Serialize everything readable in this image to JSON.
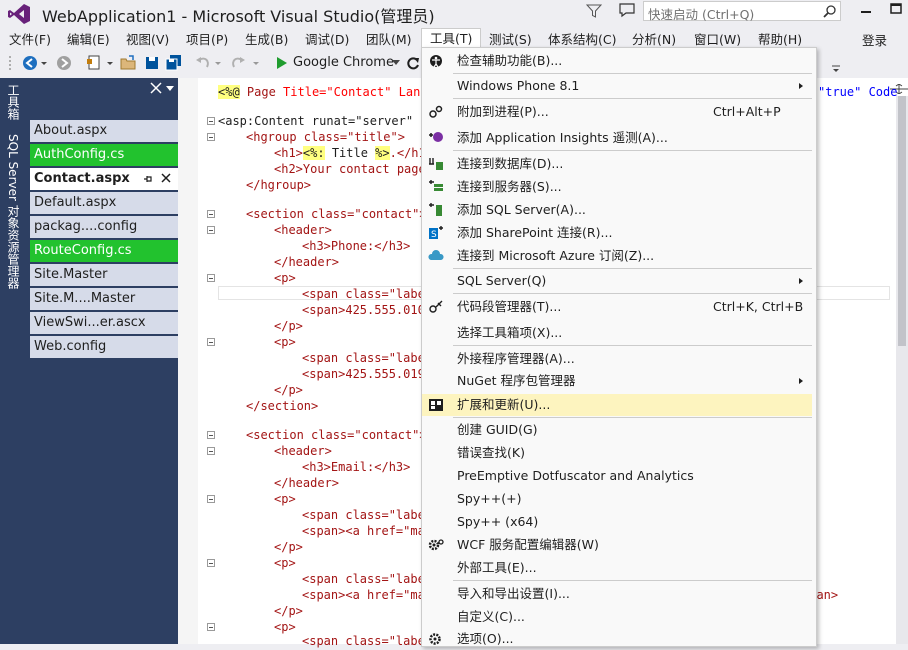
{
  "window": {
    "title": "WebApplication1 - Microsoft Visual Studio(管理员)",
    "quick_launch_placeholder": "快速启动 (Ctrl+Q)"
  },
  "menubar": {
    "items": [
      "文件(F)",
      "编辑(E)",
      "视图(V)",
      "项目(P)",
      "生成(B)",
      "调试(D)",
      "团队(M)",
      "工具(T)",
      "测试(S)",
      "体系结构(C)",
      "分析(N)",
      "窗口(W)",
      "帮助(H)"
    ],
    "login": "登录"
  },
  "toolbar": {
    "browser": "Google Chrome"
  },
  "side_tabs": [
    "工具箱",
    "SQL Server 对象资源管理器"
  ],
  "files": [
    "About.aspx",
    "AuthConfig.cs",
    "Contact.aspx",
    "Default.aspx",
    "packag....config",
    "RouteConfig.cs",
    "Site.Master",
    "Site.M....Master",
    "ViewSwi...er.ascx",
    "Web.config"
  ],
  "code": {
    "l0a": "<%@",
    "l0b": " Page ",
    "l0c": "Title=\"Contact\"",
    "l0d": " Lang",
    "l0e": "\"true\" Code",
    "l1": "<asp:Content runat=\"server\" I",
    "l2": "<hgroup class=\"title\">",
    "l3a": "<h1>",
    "l3b": "<%:",
    "l3c": " Title ",
    "l3d": "%>",
    "l3e": ".</h1",
    "l4": "<h2>Your contact page",
    "l5": "</hgroup>",
    "l6": "<section class=\"contact\">",
    "l7": "<header>",
    "l8": "<h3>Phone:</h3>",
    "l9": "</header>",
    "l10": "<p>",
    "l11": "<span class=\"labe",
    "l12": "<span>425.555.010",
    "l13": "</p>",
    "l14": "<p>",
    "l15": "<span class=\"labe",
    "l16": "<span>425.555.019",
    "l17": "</p>",
    "l18": "</section>",
    "l19": "<section class=\"contact\">",
    "l20": "<header>",
    "l21": "<h3>Email:</h3>",
    "l22": "</header>",
    "l23": "<p>",
    "l24": "<span class=\"labe",
    "l25": "<span><a href=\"ma",
    "l26": "</p>",
    "l27": "<p>",
    "l28": "<span class=\"labe",
    "l29": "<span><a href=\"ma",
    "l29b": "span>",
    "l30": "</p>",
    "l31": "<p>",
    "l32": "<span class=\"labe"
  },
  "tools_menu": {
    "items": [
      {
        "label": "检查辅助功能(B)..."
      },
      {
        "label": "Windows Phone 8.1"
      },
      {
        "label": "附加到进程(P)...",
        "shortcut": "Ctrl+Alt+P"
      },
      {
        "label": "添加 Application Insights 遥测(A)..."
      },
      {
        "label": "连接到数据库(D)..."
      },
      {
        "label": "连接到服务器(S)..."
      },
      {
        "label": "添加 SQL Server(A)..."
      },
      {
        "label": "添加 SharePoint 连接(R)..."
      },
      {
        "label": "连接到 Microsoft Azure 订阅(Z)..."
      },
      {
        "label": "SQL Server(Q)"
      },
      {
        "label": "代码段管理器(T)...",
        "shortcut": "Ctrl+K, Ctrl+B"
      },
      {
        "label": "选择工具箱项(X)..."
      },
      {
        "label": "外接程序管理器(A)..."
      },
      {
        "label": "NuGet 程序包管理器"
      },
      {
        "label": "扩展和更新(U)..."
      },
      {
        "label": "创建 GUID(G)"
      },
      {
        "label": "错误查找(K)"
      },
      {
        "label": "PreEmptive Dotfuscator and Analytics"
      },
      {
        "label": "Spy++(+)"
      },
      {
        "label": "Spy++ (x64)"
      },
      {
        "label": "WCF 服务配置编辑器(W)"
      },
      {
        "label": "外部工具(E)..."
      },
      {
        "label": "导入和导出设置(I)..."
      },
      {
        "label": "自定义(C)..."
      },
      {
        "label": "选项(O)..."
      }
    ]
  },
  "colors": {
    "accent": "#68217a",
    "panel": "#2d3f62",
    "file_bg": "#d6dbe9",
    "green": "#22c22e",
    "hover": "#fdf4bf"
  }
}
